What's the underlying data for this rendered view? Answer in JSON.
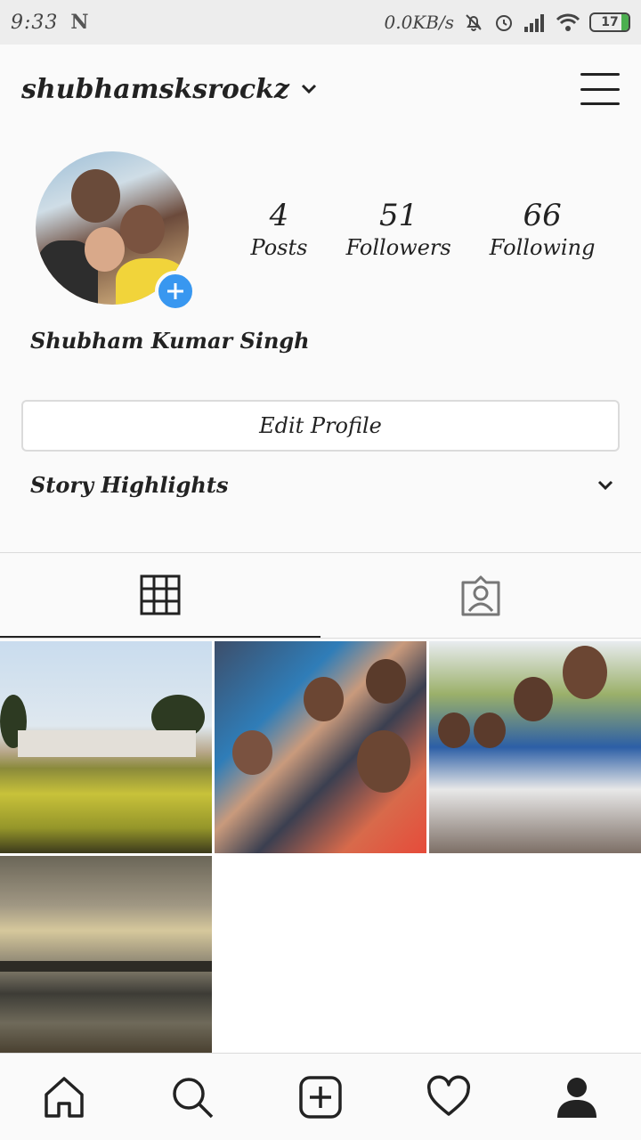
{
  "status_bar": {
    "time": "9:33",
    "network_speed": "0.0KB/s",
    "battery": "17",
    "icons": [
      "n-notification-icon",
      "mute-bell-icon",
      "alarm-icon",
      "signal-icon",
      "wifi-icon",
      "battery-icon"
    ]
  },
  "header": {
    "username": "shubhamsksrockz",
    "icons": [
      "chevron-down-icon",
      "menu-icon"
    ]
  },
  "profile": {
    "full_name": "Shubham Kumar Singh",
    "stats": [
      {
        "value": "4",
        "label": "Posts"
      },
      {
        "value": "51",
        "label": "Followers"
      },
      {
        "value": "66",
        "label": "Following"
      }
    ],
    "edit_profile_label": "Edit Profile",
    "story_highlights_label": "Story Highlights"
  },
  "tabs": [
    {
      "icon": "grid-icon",
      "active": true
    },
    {
      "icon": "tagged-icon",
      "active": false
    }
  ],
  "posts": [
    {
      "id": "post-1"
    },
    {
      "id": "post-2"
    },
    {
      "id": "post-3"
    },
    {
      "id": "post-4"
    }
  ],
  "bottom_nav": [
    {
      "icon": "home-icon"
    },
    {
      "icon": "search-icon"
    },
    {
      "icon": "add-post-icon"
    },
    {
      "icon": "heart-icon"
    },
    {
      "icon": "profile-icon"
    }
  ],
  "colors": {
    "accent_blue": "#3897f0",
    "battery_green": "#4caf50",
    "border": "#dbdbdb"
  }
}
